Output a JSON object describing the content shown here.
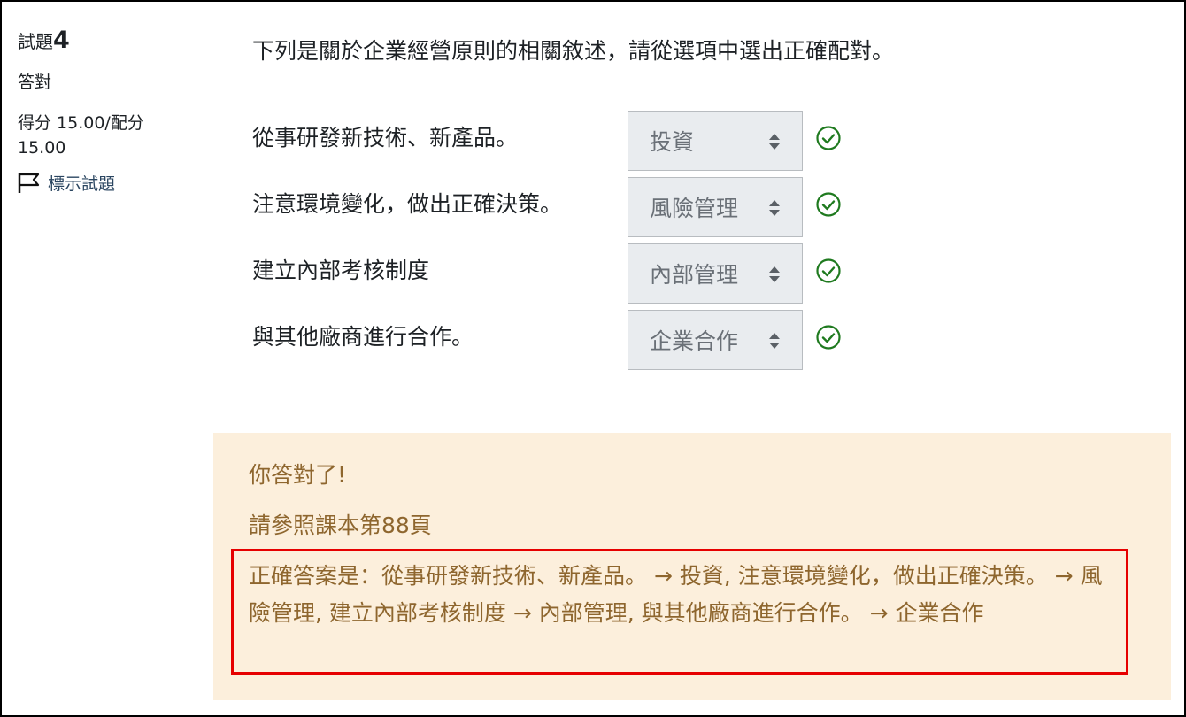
{
  "question_info": {
    "label": "試題",
    "number": "4",
    "state": "答對",
    "grade": "得分 15.00/配分 15.00",
    "flag_label": "標示試題"
  },
  "question": {
    "text": "下列是關於企業經營原則的相關敘述，請從選項中選出正確配對。",
    "items": [
      {
        "statement": "從事研發新技術、新產品。",
        "selected": "投資",
        "correct": true
      },
      {
        "statement": "注意環境變化，做出正確決策。",
        "selected": "風險管理",
        "correct": true
      },
      {
        "statement": "建立內部考核制度",
        "selected": "內部管理",
        "correct": true
      },
      {
        "statement": "與其他廠商進行合作。",
        "selected": "企業合作",
        "correct": true
      }
    ]
  },
  "feedback": {
    "general": "你答對了!",
    "reference": "請參照課本第88頁",
    "right_answer": "正確答案是：從事研發新技術、新產品。 → 投資, 注意環境變化，做出正確決策。 → 風險管理, 建立內部考核制度 → 內部管理, 與其他廠商進行合作。 → 企業合作"
  },
  "colors": {
    "correct_green": "#1f7a1f",
    "feedback_bg": "#fcefdc",
    "feedback_text": "#8e662e",
    "highlight_border": "#e60000"
  },
  "icons": [
    "flag-icon",
    "select-arrows-icon",
    "check-circle-icon"
  ]
}
